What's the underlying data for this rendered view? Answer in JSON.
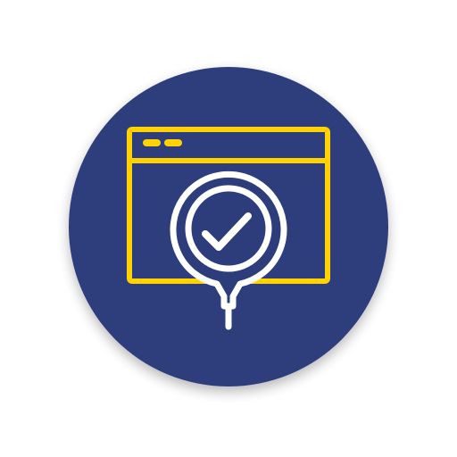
{
  "icon": {
    "name": "website-verified-pin-icon",
    "badge_color": "#2D3C7B",
    "window_color": "#FFD200",
    "pin_color": "#FFFFFF",
    "shadow_color": "#000000",
    "background_color": "#FFFFFF"
  }
}
